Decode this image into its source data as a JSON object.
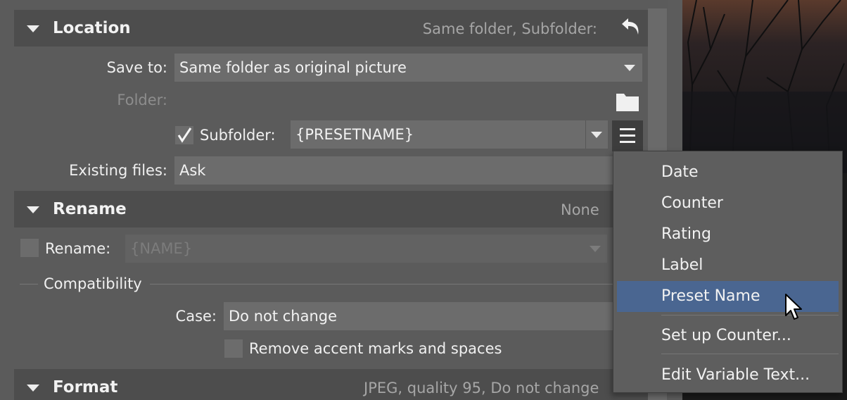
{
  "location": {
    "title": "Location",
    "summary": "Same folder, Subfolder:",
    "save_to_label": "Save to:",
    "save_to_value": "Same folder as original picture",
    "folder_label": "Folder:",
    "subfolder_label": "Subfolder:",
    "subfolder_value": "{PRESETNAME}",
    "subfolder_checked": true,
    "existing_files_label": "Existing files:",
    "existing_files_value": "Ask"
  },
  "rename": {
    "title": "Rename",
    "summary": "None",
    "rename_label": "Rename:",
    "rename_value": "{NAME}",
    "rename_checked": false,
    "compat_title": "Compatibility",
    "case_label": "Case:",
    "case_value": "Do not change",
    "remove_accents_label": "Remove accent marks and spaces",
    "remove_accents_checked": false
  },
  "format": {
    "title": "Format",
    "summary": "JPEG, quality 95, Do not change"
  },
  "menu": {
    "items": [
      "Date",
      "Counter",
      "Rating",
      "Label",
      "Preset Name"
    ],
    "highlighted": "Preset Name",
    "setup_counter": "Set up Counter...",
    "edit_variable_text": "Edit Variable Text..."
  },
  "colors": {
    "panel_bg": "#5b5b5b",
    "header_bg": "#4d4d4d",
    "field_bg": "#6c6c6c",
    "menu_highlight": "#4a6691"
  }
}
